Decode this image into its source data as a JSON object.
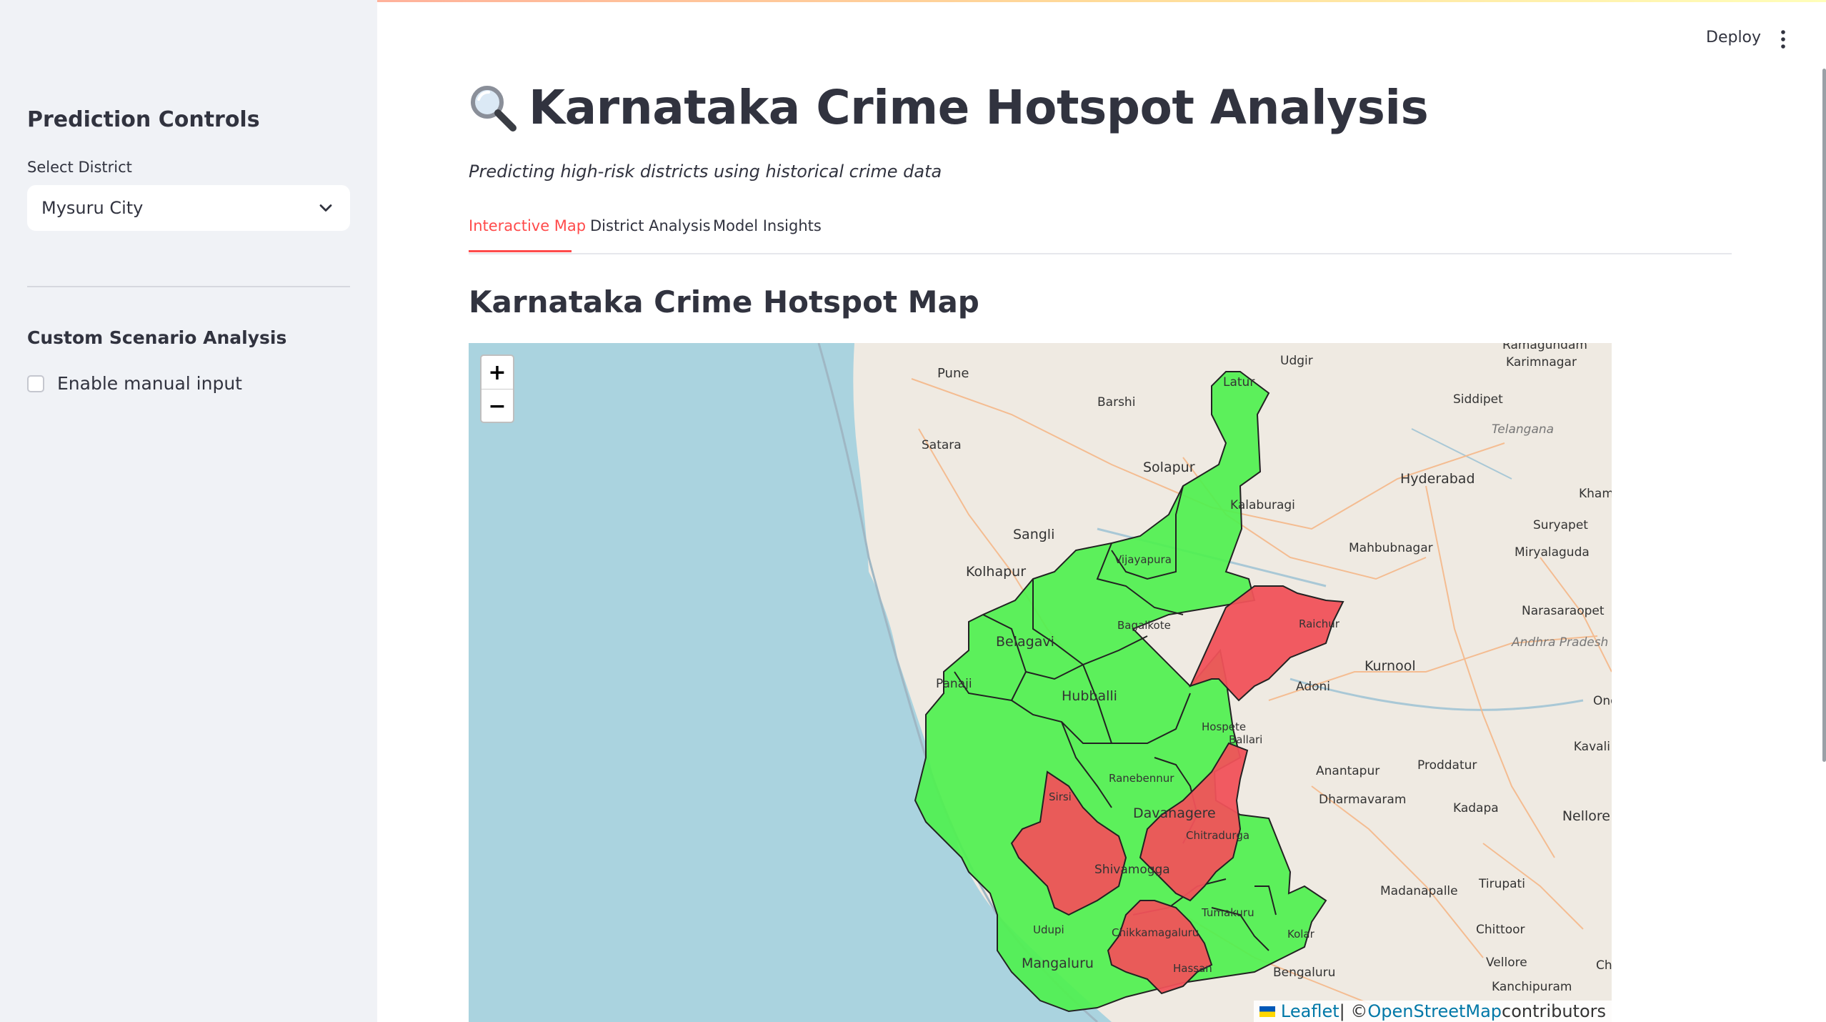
{
  "sidebar": {
    "heading": "Prediction Controls",
    "district_label": "Select District",
    "district_value": "Mysuru City",
    "custom_heading": "Custom Scenario Analysis",
    "manual_input_label": "Enable manual input"
  },
  "header": {
    "deploy_label": "Deploy",
    "menu_icon": "kebab-menu-icon"
  },
  "main": {
    "title_icon": "magnifier-icon",
    "title": "Karnataka Crime Hotspot Analysis",
    "subtitle": "Predicting high-risk districts using historical crime data",
    "tabs": [
      {
        "label": "Interactive Map",
        "active": true
      },
      {
        "label": "District Analysis",
        "active": false
      },
      {
        "label": "Model Insights",
        "active": false
      }
    ],
    "map_heading": "Karnataka Crime Hotspot Map"
  },
  "map": {
    "zoom_in": "+",
    "zoom_out": "−",
    "attribution": {
      "leaflet": "Leaflet",
      "sep": " | © ",
      "osm": "OpenStreetMap",
      "tail": " contributors"
    },
    "colors": {
      "low_risk": "#4ff04f",
      "high_risk": "#f0525a",
      "water": "#aad3df",
      "land": "#efeae2"
    },
    "place_labels": [
      "Ramagundam",
      "Pune",
      "Udgir",
      "Karimnagar",
      "Latur",
      "Barshi",
      "Siddipet",
      "Satara",
      "Telangana",
      "Solapur",
      "Hyderabad",
      "Kalaburagi",
      "Khammam",
      "Suryapet",
      "Sangli",
      "Vijayapura",
      "Mahbubnagar",
      "Miryalaguda",
      "Kolhapur",
      "Raichur",
      "Narasaraopet",
      "Bagalkote",
      "Andhra Pradesh",
      "Belagavi",
      "Kurnool",
      "Panaji",
      "Adoni",
      "Ongole",
      "Hubballi",
      "Hospete",
      "Ballari",
      "Kavali",
      "Anantapur",
      "Proddatur",
      "Ranebennur",
      "Sirsi",
      "Dharmavaram",
      "Kadapa",
      "Davanagere",
      "Nellore",
      "Chitradurga",
      "Shivamogga",
      "Tumakuru",
      "Madanapalle",
      "Tirupati",
      "Udupi",
      "Chikkamagaluru",
      "Kolar",
      "Chittoor",
      "Mangaluru",
      "Hassan",
      "Bengaluru",
      "Vellore",
      "Kanchipuram",
      "Chennai"
    ],
    "hotspot_districts": [
      "Raichur",
      "Shivamogga",
      "Chitradurga",
      "Hassan"
    ]
  }
}
